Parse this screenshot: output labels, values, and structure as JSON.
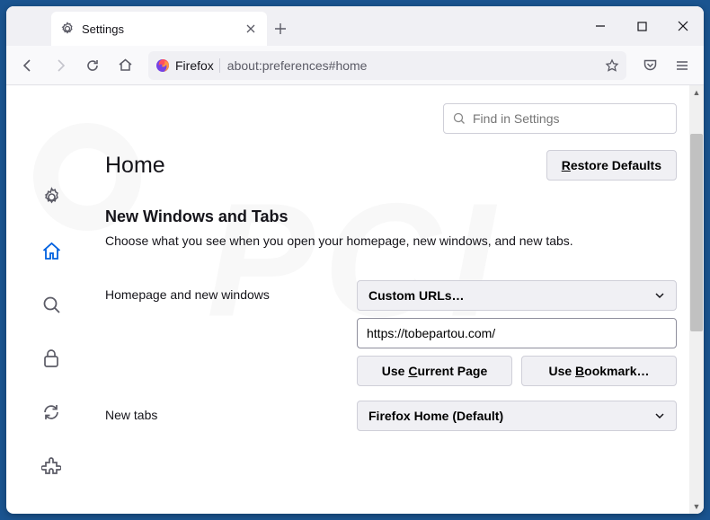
{
  "tab": {
    "title": "Settings"
  },
  "urlbar": {
    "prefix": "Firefox",
    "path": "about:preferences#home"
  },
  "search": {
    "placeholder": "Find in Settings"
  },
  "page": {
    "title": "Home",
    "restore": "Restore Defaults",
    "section_title": "New Windows and Tabs",
    "section_sub": "Choose what you see when you open your homepage, new windows, and new tabs."
  },
  "homepage": {
    "label": "Homepage and new windows",
    "dropdown": "Custom URLs…",
    "url": "https://tobepartou.com/",
    "use_current": "Use Current Page",
    "use_bookmark": "Use Bookmark…"
  },
  "newtabs": {
    "label": "New tabs",
    "dropdown": "Firefox Home (Default)"
  }
}
